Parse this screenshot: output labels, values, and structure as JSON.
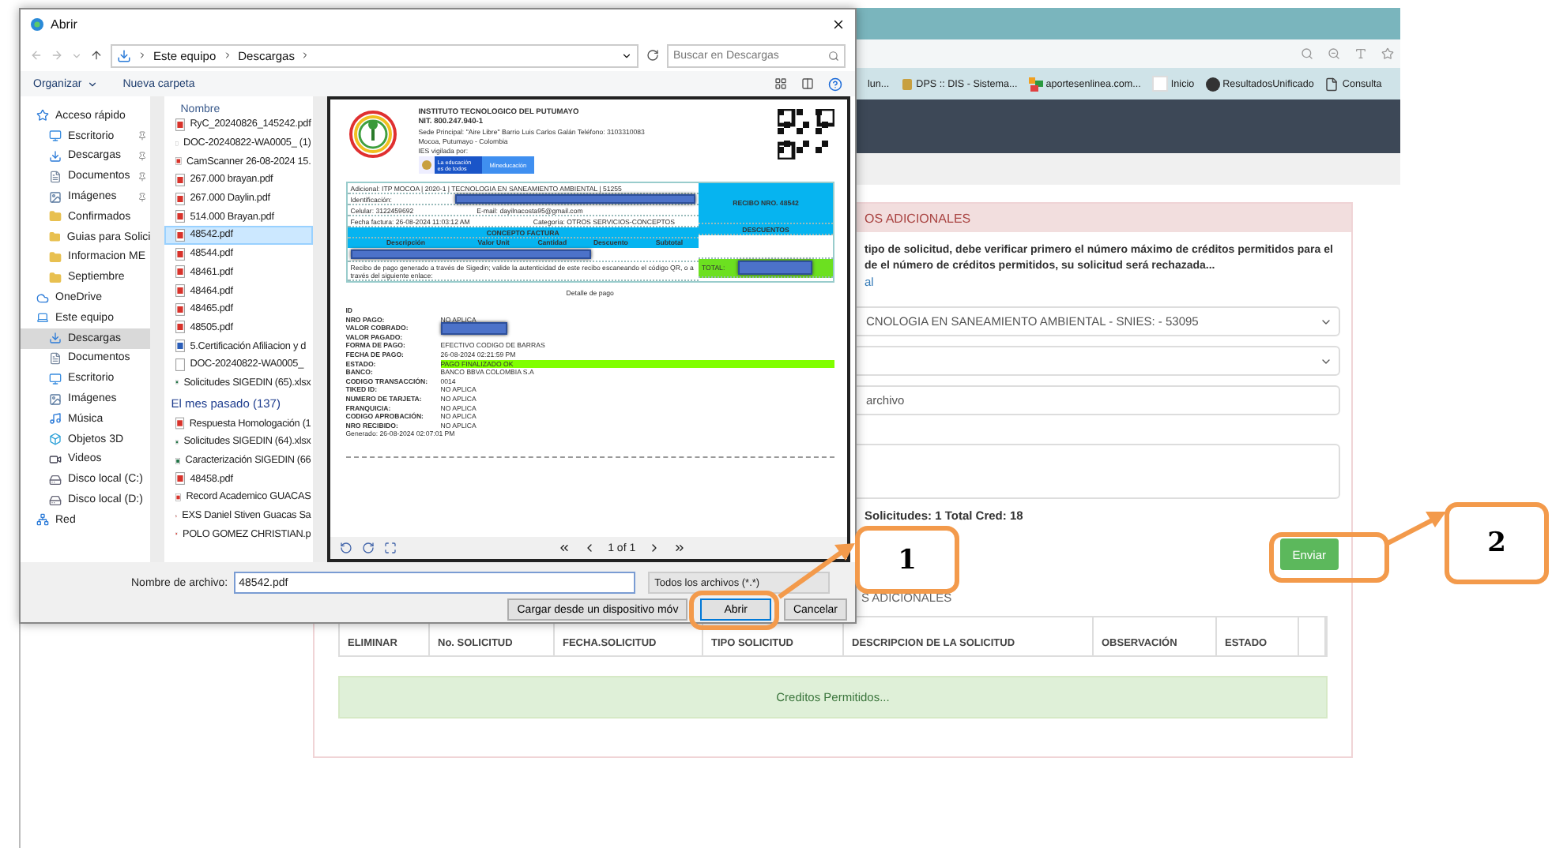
{
  "browser": {
    "bookmarks": [
      {
        "label": "lun...",
        "kind": "none"
      },
      {
        "label": "DPS :: DIS - Sistema...",
        "kind": "crest"
      },
      {
        "label": "aportesenlinea.com...",
        "kind": "colors"
      },
      {
        "label": "Inicio",
        "kind": "blank"
      },
      {
        "label": "ResultadosUnificado",
        "kind": "round"
      },
      {
        "label": "Consulta",
        "kind": "page"
      }
    ]
  },
  "page": {
    "card_title": "OS ADICIONALES",
    "notice": [
      "tipo de solicitud, debe verificar primero el número máximo de créditos permitidos para el",
      "de el número de créditos permitidos, su solicitud será rechazada..."
    ],
    "link": "al",
    "program_select": {
      "value": "CNOLOGIA EN SANEAMIENTO AMBIENTAL - SNIES: - 53095"
    },
    "file_field": {
      "value": "archivo"
    },
    "summary": "Solicitudes: 1 Total Cred: 18",
    "send_button": "Enviar",
    "table": {
      "title": "S ADICIONALES",
      "columns": [
        "ELIMINAR",
        "No. SOLICITUD",
        "FECHA.SOLICITUD",
        "TIPO SOLICITUD",
        "DESCRIPCION DE LA SOLICITUD",
        "OBSERVACIÓN",
        "ESTADO"
      ]
    },
    "alert": "Creditos Permitidos..."
  },
  "dialog": {
    "title": "Abrir",
    "path": [
      "Este equipo",
      "Descargas"
    ],
    "search": {
      "placeholder": "Buscar en Descargas"
    },
    "toolbar": [
      "Organizar",
      "Nueva carpeta"
    ],
    "nav": [
      {
        "label": "Acceso rápido",
        "kind": "star",
        "pinned": false,
        "selected": false
      },
      {
        "label": "Escritorio",
        "kind": "desktop",
        "pinned": true,
        "selected": false
      },
      {
        "label": "Descargas",
        "kind": "download",
        "pinned": true,
        "selected": false
      },
      {
        "label": "Documentos",
        "kind": "docs",
        "pinned": true,
        "selected": false
      },
      {
        "label": "Imágenes",
        "kind": "images",
        "pinned": true,
        "selected": false
      },
      {
        "label": "Confirmados",
        "kind": "folder",
        "pinned": false,
        "selected": false
      },
      {
        "label": "Guias para Solici",
        "kind": "folder",
        "pinned": false,
        "selected": false
      },
      {
        "label": "Informacion ME",
        "kind": "folder",
        "pinned": false,
        "selected": false
      },
      {
        "label": "Septiembre",
        "kind": "folder",
        "pinned": false,
        "selected": false
      },
      {
        "label": "OneDrive",
        "kind": "cloud",
        "pinned": false,
        "selected": false
      },
      {
        "label": "Este equipo",
        "kind": "pc",
        "pinned": false,
        "selected": false
      },
      {
        "label": "Descargas",
        "kind": "download",
        "pinned": false,
        "selected": true
      },
      {
        "label": "Documentos",
        "kind": "docs",
        "pinned": false,
        "selected": false
      },
      {
        "label": "Escritorio",
        "kind": "desktop",
        "pinned": false,
        "selected": false
      },
      {
        "label": "Imágenes",
        "kind": "images",
        "pinned": false,
        "selected": false
      },
      {
        "label": "Música",
        "kind": "music",
        "pinned": false,
        "selected": false
      },
      {
        "label": "Objetos 3D",
        "kind": "cube",
        "pinned": false,
        "selected": false
      },
      {
        "label": "Videos",
        "kind": "video",
        "pinned": false,
        "selected": false
      },
      {
        "label": "Disco local (C:)",
        "kind": "drive",
        "pinned": false,
        "selected": false
      },
      {
        "label": "Disco local (D:)",
        "kind": "drive",
        "pinned": false,
        "selected": false
      },
      {
        "label": "Red",
        "kind": "network",
        "pinned": false,
        "selected": false
      }
    ],
    "files_header": "Nombre",
    "files": [
      {
        "kind": "pdf",
        "name": "RyC_20240826_145242.pdf",
        "selected": false
      },
      {
        "kind": "blank",
        "name": "DOC-20240822-WA0005_ (1)",
        "selected": false
      },
      {
        "kind": "pdf",
        "name": "CamScanner 26-08-2024 15.",
        "selected": false
      },
      {
        "kind": "pdf",
        "name": "267.000 brayan.pdf",
        "selected": false
      },
      {
        "kind": "pdf",
        "name": "267.000 Daylin.pdf",
        "selected": false
      },
      {
        "kind": "pdf",
        "name": "514.000 Brayan.pdf",
        "selected": false
      },
      {
        "kind": "pdf",
        "name": "48542.pdf",
        "selected": true
      },
      {
        "kind": "pdf",
        "name": "48544.pdf",
        "selected": false
      },
      {
        "kind": "pdf",
        "name": "48461.pdf",
        "selected": false
      },
      {
        "kind": "pdf",
        "name": "48464.pdf",
        "selected": false
      },
      {
        "kind": "pdf",
        "name": "48465.pdf",
        "selected": false
      },
      {
        "kind": "pdf",
        "name": "48505.pdf",
        "selected": false
      },
      {
        "kind": "word",
        "name": "5.Certificación Afiliacion y d",
        "selected": false
      },
      {
        "kind": "blank",
        "name": "DOC-20240822-WA0005_",
        "selected": false
      },
      {
        "kind": "excel",
        "name": "Solicitudes SIGEDIN (65).xlsx",
        "selected": false
      },
      {
        "kind": "group",
        "name": "El mes pasado (137)"
      },
      {
        "kind": "pdf",
        "name": "Respuesta Homologación (1",
        "selected": false
      },
      {
        "kind": "excel",
        "name": "Solicitudes SIGEDIN (64).xlsx",
        "selected": false
      },
      {
        "kind": "excel",
        "name": "Caracterización SIGEDIN (66",
        "selected": false
      },
      {
        "kind": "pdf",
        "name": "48458.pdf",
        "selected": false
      },
      {
        "kind": "pdf",
        "name": "Record Academico GUACAS",
        "selected": false
      },
      {
        "kind": "pdf",
        "name": "EXS Daniel Stiven Guacas Sa",
        "selected": false
      },
      {
        "kind": "pdf",
        "name": "POLO GOMEZ CHRISTIAN.p",
        "selected": false
      }
    ],
    "preview": {
      "institution": "INSTITUTO TECNOLOGICO DEL PUTUMAYO",
      "nit": "NIT. 800.247.940-1",
      "address": "Sede Principal: \"Aire Libre\" Barrio Luis Carlos Galán Teléfono: 3103310083",
      "city": "Mocoa, Putumayo - Colombia",
      "oversight": "IES vigilada por:",
      "badge": "La educación es de todos",
      "ministry": "Mineducación",
      "program": "Adicional: ITP MOCOA | 2020-1 | TECNOLOGIA EN SANEAMIENTO AMBIENTAL | 51255",
      "id_label": "Identificación:",
      "phone": "Celular: 3122459692",
      "email": "E-mail: dayilnacosta95@gmail.com",
      "date": "Fecha factura: 26-08-2024 11:03:12 AM",
      "category": "Categoría: OTROS SERVICIOS-CONCEPTOS",
      "receipt": "RECIBO NRO. 48542",
      "concept": "CONCEPTO FACTURA",
      "discounts": "DESCUENTOS",
      "columns": [
        "Descripción",
        "Valor Unit",
        "Cantidad",
        "Descuento",
        "Subtotal"
      ],
      "note": "Recibo de pago generado a través de Sigedin; valide la autenticidad de este recibo escaneando el código QR, o a través del siguiente enlace:",
      "total": "TOTAL:",
      "detail_title": "Detalle de pago",
      "details": [
        {
          "label": "ID",
          "highlighted": false,
          "redacted": false
        },
        {
          "label": "NRO PAGO:",
          "value": "NO APLICA",
          "highlighted": false,
          "redacted": false
        },
        {
          "label": "VALOR COBRADO:",
          "highlighted": false,
          "redacted": true
        },
        {
          "label": "VALOR PAGADO:",
          "highlighted": false,
          "redacted": false
        },
        {
          "label": "FORMA DE PAGO:",
          "value": "EFECTIVO CODIGO DE BARRAS",
          "highlighted": false,
          "redacted": false
        },
        {
          "label": "FECHA DE PAGO:",
          "value": "26-08-2024 02:21:59 PM",
          "highlighted": false,
          "redacted": false
        },
        {
          "label": "ESTADO:",
          "value": "PAGO FINALIZADO OK",
          "highlighted": true,
          "redacted": false
        },
        {
          "label": "BANCO:",
          "value": "BANCO BBVA COLOMBIA S.A",
          "highlighted": false,
          "redacted": false
        },
        {
          "label": "CODIGO TRANSACCIÓN:",
          "value": "0014",
          "highlighted": false,
          "redacted": false
        },
        {
          "label": "TIKED ID:",
          "value": "NO APLICA",
          "highlighted": false,
          "redacted": false
        },
        {
          "label": "NUMERO DE TARJETA:",
          "value": "NO APLICA",
          "highlighted": false,
          "redacted": false
        },
        {
          "label": "FRANQUICIA:",
          "value": "NO APLICA",
          "highlighted": false,
          "redacted": false
        },
        {
          "label": "CODIGO APROBACIÓN:",
          "value": "NO APLICA",
          "highlighted": false,
          "redacted": false
        },
        {
          "label": "NRO RECIBIDO:",
          "value": "NO APLICA",
          "highlighted": false,
          "redacted": false
        }
      ],
      "generated": "Generado: 26-08-2024 02:07:01 PM",
      "page": "1 of 1"
    },
    "filename": {
      "label": "Nombre de archivo:",
      "value": "48542.pdf"
    },
    "filter": "Todos los archivos (*.*)",
    "buttons": [
      {
        "label": "Cargar desde un dispositivo móv",
        "kind": "plain"
      },
      {
        "label": "Abrir",
        "kind": "default"
      },
      {
        "label": "Cancelar",
        "kind": "plain"
      }
    ]
  },
  "callouts": [
    {
      "label": "1"
    },
    {
      "label": "2"
    }
  ]
}
